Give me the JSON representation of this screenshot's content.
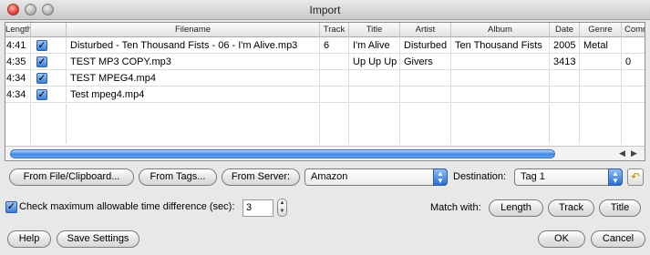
{
  "window": {
    "title": "Import"
  },
  "table": {
    "columns": [
      "Length",
      "Filename",
      "Track",
      "Title",
      "Artist",
      "Album",
      "Date",
      "Genre",
      "Comm"
    ],
    "rows": [
      {
        "length": "4:41",
        "checked": true,
        "filename": "Disturbed - Ten Thousand Fists - 06 - I'm Alive.mp3",
        "track": "6",
        "title": "I'm Alive",
        "artist": "Disturbed",
        "album": "Ten Thousand Fists",
        "date": "2005",
        "genre": "Metal",
        "comment": ""
      },
      {
        "length": "4:35",
        "checked": true,
        "filename": "TEST MP3 COPY.mp3",
        "track": "",
        "title": "Up Up Up",
        "artist": "Givers",
        "album": "",
        "date": "3413",
        "genre": "",
        "comment": "0"
      },
      {
        "length": "4:34",
        "checked": true,
        "filename": "TEST MPEG4.mp4",
        "track": "",
        "title": "",
        "artist": "",
        "album": "",
        "date": "",
        "genre": "",
        "comment": ""
      },
      {
        "length": "4:34",
        "checked": true,
        "filename": "Test mpeg4.mp4",
        "track": "",
        "title": "",
        "artist": "",
        "album": "",
        "date": "",
        "genre": "",
        "comment": ""
      }
    ]
  },
  "source_buttons": {
    "from_file": "From File/Clipboard...",
    "from_tags": "From Tags...",
    "from_server": "From Server:"
  },
  "server_select": {
    "value": "Amazon"
  },
  "destination": {
    "label": "Destination:",
    "value": "Tag 1"
  },
  "time_check": {
    "checked": true,
    "label": "Check maximum allowable time difference (sec):",
    "value": "3"
  },
  "match": {
    "label": "Match with:",
    "buttons": [
      "Length",
      "Track",
      "Title"
    ]
  },
  "footer": {
    "help": "Help",
    "save_settings": "Save Settings",
    "ok": "OK",
    "cancel": "Cancel"
  },
  "icons": {
    "check": "checkmark-icon",
    "undo": "undo-icon"
  }
}
